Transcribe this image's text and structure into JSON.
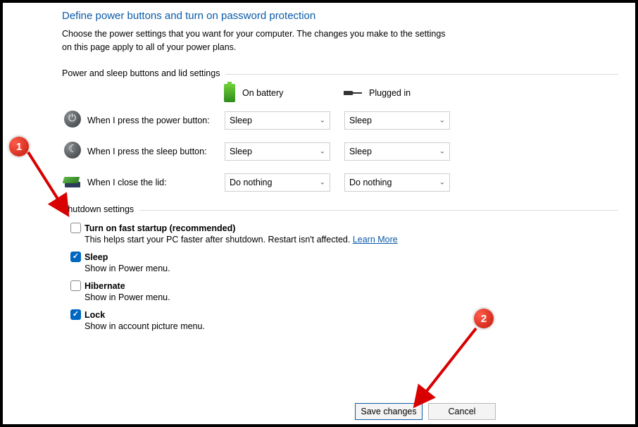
{
  "title": "Define power buttons and turn on password protection",
  "desc": "Choose the power settings that you want for your computer. The changes you make to the settings on this page apply to all of your power plans.",
  "section1": "Power and sleep buttons and lid settings",
  "cols": {
    "battery": "On battery",
    "plugged": "Plugged in"
  },
  "rows": {
    "power": {
      "label": "When I press the power button:",
      "batt": "Sleep",
      "plug": "Sleep"
    },
    "sleep": {
      "label": "When I press the sleep button:",
      "batt": "Sleep",
      "plug": "Sleep"
    },
    "lid": {
      "label": "When I close the lid:",
      "batt": "Do nothing",
      "plug": "Do nothing"
    }
  },
  "section2": "Shutdown settings",
  "shutdown": {
    "fast": {
      "checked": false,
      "label": "Turn on fast startup (recommended)",
      "sub": "This helps start your PC faster after shutdown. Restart isn't affected. ",
      "link": "Learn More"
    },
    "sleep": {
      "checked": true,
      "label": "Sleep",
      "sub": "Show in Power menu."
    },
    "hib": {
      "checked": false,
      "label": "Hibernate",
      "sub": "Show in Power menu."
    },
    "lock": {
      "checked": true,
      "label": "Lock",
      "sub": "Show in account picture menu."
    }
  },
  "buttons": {
    "save": "Save changes",
    "cancel": "Cancel"
  },
  "callouts": {
    "one": "1",
    "two": "2"
  }
}
